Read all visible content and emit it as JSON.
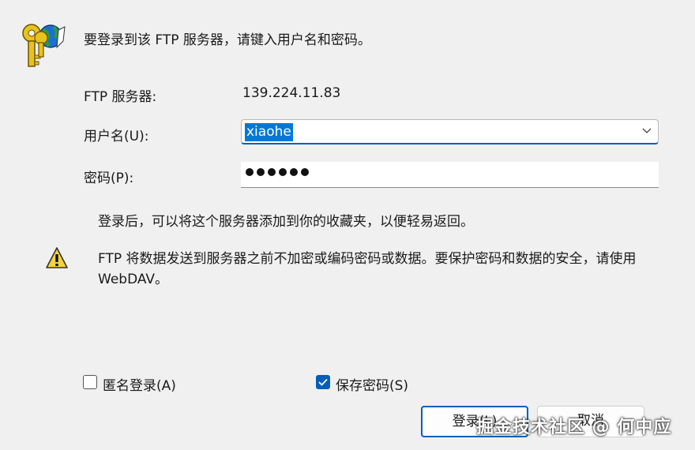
{
  "intro": "要登录到该 FTP 服务器，请键入用户名和密码。",
  "server": {
    "label": "FTP 服务器:",
    "value": "139.224.11.83"
  },
  "username": {
    "label": "用户名(U):",
    "value": "xiaohe"
  },
  "password": {
    "label": "密码(P):",
    "masked_length": 6
  },
  "note": "登录后，可以将这个服务器添加到你的收藏夹，以便轻易返回。",
  "warning": "FTP 将数据发送到服务器之前不加密或编码密码或数据。要保护密码和数据的安全，请使用 WebDAV。",
  "anonymous": {
    "label": "匿名登录(A)",
    "checked": false
  },
  "save_password": {
    "label": "保存密码(S)",
    "checked": true
  },
  "buttons": {
    "login": "登录(L)",
    "cancel": "取消"
  },
  "watermark": "掘金技术社区 @ 何中应",
  "colors": {
    "accent": "#005fb8",
    "selection": "#0078d7",
    "background": "#f0f0f0"
  },
  "icons": {
    "header": "keys-globe-icon",
    "warning": "warning-icon"
  }
}
